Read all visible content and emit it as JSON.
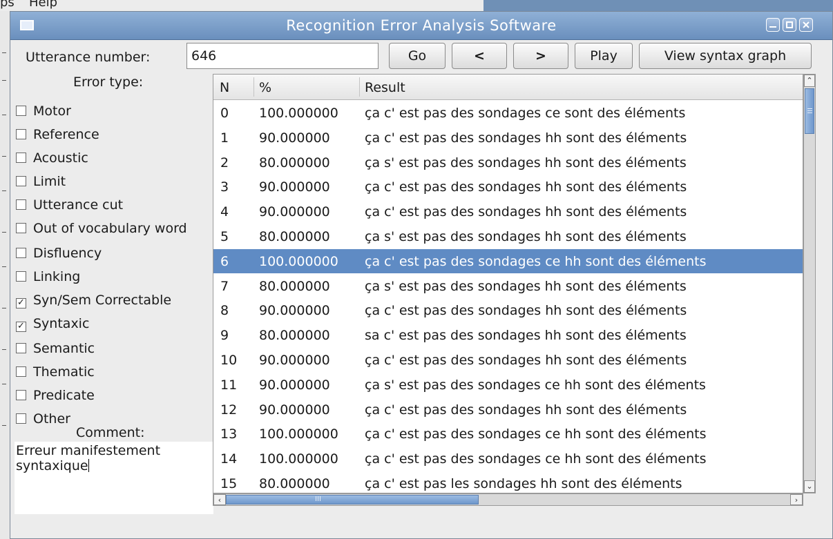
{
  "background": {
    "menu_items": [
      "ps",
      "Help"
    ]
  },
  "window": {
    "title": "Recognition Error Analysis Software"
  },
  "toolbar": {
    "utterance_label": "Utterance number:",
    "utterance_value": "646",
    "go_label": "Go",
    "prev_label": "<",
    "next_label": ">",
    "play_label": "Play",
    "syntax_graph_label": "View syntax graph"
  },
  "error_panel": {
    "title": "Error type:",
    "items": [
      {
        "label": "Motor",
        "checked": false
      },
      {
        "label": "Reference",
        "checked": false
      },
      {
        "label": "Acoustic",
        "checked": false
      },
      {
        "label": "Limit",
        "checked": false
      },
      {
        "label": "Utterance cut",
        "checked": false
      },
      {
        "label": "Out of vocabulary word",
        "checked": false
      },
      {
        "label": "Disfluency",
        "checked": false
      },
      {
        "label": "Linking",
        "checked": false
      },
      {
        "label": "Syn/Sem Correctable",
        "checked": true
      },
      {
        "label": "Syntaxic",
        "checked": true
      },
      {
        "label": "Semantic",
        "checked": false
      },
      {
        "label": "Thematic",
        "checked": false
      },
      {
        "label": "Predicate",
        "checked": false
      },
      {
        "label": "Other",
        "checked": false
      }
    ],
    "comment_label": "Comment:",
    "comment_text": "Erreur manifestement\nsyntaxique"
  },
  "results_table": {
    "columns": [
      "N",
      "%",
      "Result"
    ],
    "selected_index": 6,
    "rows": [
      [
        "0",
        "100.000000",
        "ça c' est pas des sondages ce sont des éléments"
      ],
      [
        "1",
        "90.000000",
        "ça c' est pas des sondages hh sont des éléments"
      ],
      [
        "2",
        "80.000000",
        "ça s' est pas des sondages hh sont des éléments"
      ],
      [
        "3",
        "90.000000",
        "ça c' est pas des sondages hh sont des éléments"
      ],
      [
        "4",
        "90.000000",
        "ça c' est pas des sondages hh sont des éléments"
      ],
      [
        "5",
        "80.000000",
        "ça s' est pas des sondages hh sont des éléments"
      ],
      [
        "6",
        "100.000000",
        "ça c' est pas des sondages ce hh sont des éléments"
      ],
      [
        "7",
        "80.000000",
        "ça s' est pas des sondages hh sont des éléments"
      ],
      [
        "8",
        "90.000000",
        "ça c' est pas des sondages hh sont des éléments"
      ],
      [
        "9",
        "80.000000",
        "sa c' est pas des sondages hh sont des éléments"
      ],
      [
        "10",
        "90.000000",
        "ça c' est pas des sondages hh sont des éléments"
      ],
      [
        "11",
        "90.000000",
        "ça s' est pas des sondages ce hh sont des éléments"
      ],
      [
        "12",
        "90.000000",
        "ça c' est pas des sondages hh sont des éléments"
      ],
      [
        "13",
        "100.000000",
        "ça c' est pas des sondages ce hh sont des éléments"
      ],
      [
        "14",
        "100.000000",
        "ça c' est pas des sondages ce hh sont des éléments"
      ],
      [
        "15",
        "80.000000",
        "ça c' est pas les sondages hh sont des éléments"
      ]
    ]
  },
  "colors": {
    "titlebar": "#6a8fbd",
    "selection": "#5f8bc4",
    "scroll_thumb": "#6e97cc"
  },
  "icons": {
    "scroll_up": "chevron-up-icon",
    "scroll_down": "chevron-down-icon",
    "scroll_left": "chevron-left-icon",
    "scroll_right": "chevron-right-icon"
  }
}
